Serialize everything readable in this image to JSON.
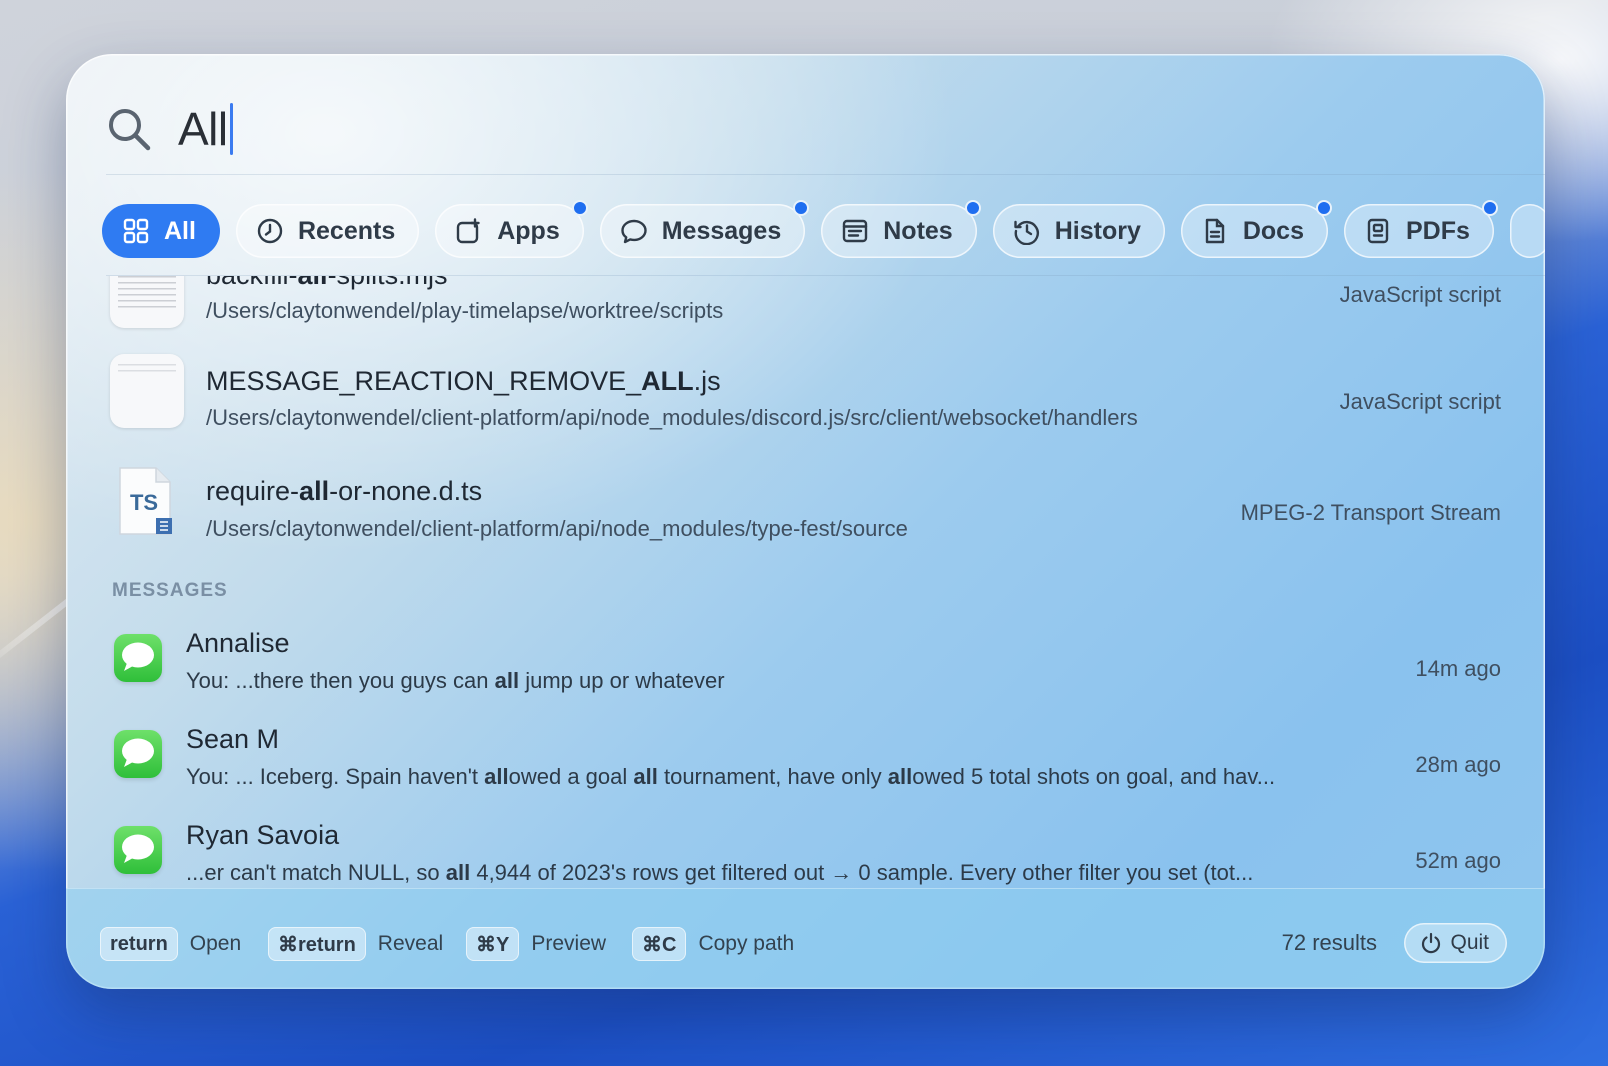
{
  "search": {
    "query": "All"
  },
  "tabs": [
    {
      "label": "All",
      "icon": "grid-icon",
      "active": true,
      "dot": false
    },
    {
      "label": "Recents",
      "icon": "clock-icon",
      "active": false,
      "dot": false
    },
    {
      "label": "Apps",
      "icon": "app-icon",
      "active": false,
      "dot": true
    },
    {
      "label": "Messages",
      "icon": "chat-bubble-icon",
      "active": false,
      "dot": true
    },
    {
      "label": "Notes",
      "icon": "notes-icon",
      "active": false,
      "dot": true
    },
    {
      "label": "History",
      "icon": "history-icon",
      "active": false,
      "dot": false
    },
    {
      "label": "Docs",
      "icon": "document-icon",
      "active": false,
      "dot": true
    },
    {
      "label": "PDFs",
      "icon": "pdf-icon",
      "active": false,
      "dot": true
    }
  ],
  "files": [
    {
      "name_parts": [
        "backfill-",
        "all",
        "-splits.mjs"
      ],
      "path": "/Users/claytonwendel/play-timelapse/worktree/scripts",
      "kind": "JavaScript script",
      "icon": "script-file-icon"
    },
    {
      "name_parts": [
        "MESSAGE_REACTION_REMOVE_",
        "ALL",
        ".js"
      ],
      "path": "/Users/claytonwendel/client-platform/api/node_modules/discord.js/src/client/websocket/handlers",
      "kind": "JavaScript script",
      "icon": "script-file-icon"
    },
    {
      "name_parts": [
        "require-",
        "all",
        "-or-none.d.ts"
      ],
      "path": "/Users/claytonwendel/client-platform/api/node_modules/type-fest/source",
      "kind": "MPEG-2 Transport Stream",
      "icon": "typescript-file-icon",
      "icon_text": "TS"
    }
  ],
  "messages_section": {
    "label": "MESSAGES",
    "items": [
      {
        "name": "Annalise",
        "text_parts": [
          "You: ...there then you guys can ",
          "all",
          " jump up or whatever"
        ],
        "time": "14m ago"
      },
      {
        "name": "Sean M",
        "text_parts": [
          "You: ... Iceberg. Spain haven't ",
          "all",
          "owed a goal ",
          "all",
          " tournament, have only ",
          "all",
          "owed 5 total shots on goal, and hav..."
        ],
        "time": "28m ago"
      },
      {
        "name": "Ryan Savoia",
        "text_parts": [
          "...er can't match NULL, so ",
          "all",
          " 4,944 of 2023's rows get filtered out → 0 sample. Every other filter you set (tot..."
        ],
        "time": "52m ago"
      }
    ]
  },
  "footer": {
    "hints": [
      {
        "key": "return",
        "label": "Open"
      },
      {
        "key": "⌘return",
        "label": "Reveal"
      },
      {
        "key": "⌘Y",
        "label": "Preview"
      },
      {
        "key": "⌘C",
        "label": "Copy path"
      }
    ],
    "results_count": "72 results",
    "quit_label": "Quit"
  },
  "colors": {
    "accent": "#2f7bf2",
    "messages_green": "#34c759"
  }
}
